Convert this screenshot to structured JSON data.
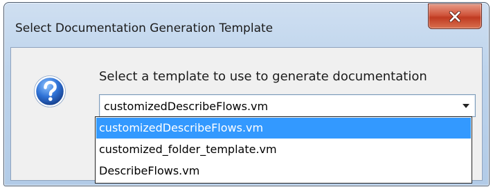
{
  "window": {
    "title": "Select Documentation Generation Template",
    "close_icon": "close-icon"
  },
  "dialog": {
    "icon": "question-icon",
    "prompt": "Select a template to use to generate documentation",
    "combo": {
      "selected": "customizedDescribeFlows.vm",
      "arrow_icon": "chevron-down-icon"
    },
    "options": [
      {
        "label": "customizedDescribeFlows.vm",
        "highlighted": true
      },
      {
        "label": "customized_folder_template.vm",
        "highlighted": false
      },
      {
        "label": "DescribeFlows.vm",
        "highlighted": false
      }
    ]
  },
  "colors": {
    "highlight": "#3399ff",
    "close_button": "#c03b22",
    "title_bar": "#bcd3ec"
  }
}
